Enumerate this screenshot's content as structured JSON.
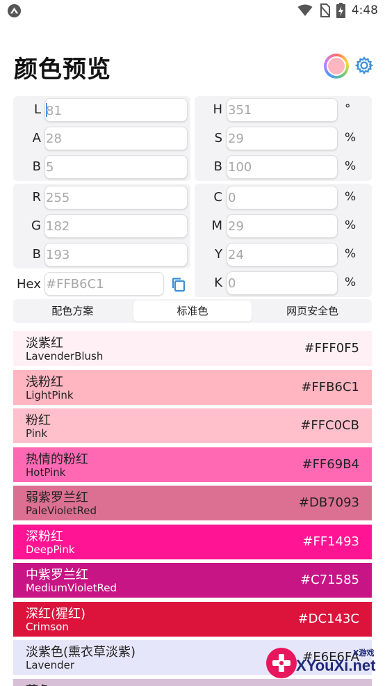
{
  "status_bar": {
    "time": "4:48"
  },
  "header": {
    "title": "颜色预览",
    "preview_color": "#FFB6C1"
  },
  "lab": {
    "rows": [
      {
        "label": "L",
        "value": "81"
      },
      {
        "label": "A",
        "value": "28"
      },
      {
        "label": "B",
        "value": "5"
      }
    ]
  },
  "hsb": {
    "rows": [
      {
        "label": "H",
        "value": "351",
        "unit": "°"
      },
      {
        "label": "S",
        "value": "29",
        "unit": "%"
      },
      {
        "label": "B",
        "value": "100",
        "unit": "%"
      }
    ]
  },
  "rgb": {
    "rows": [
      {
        "label": "R",
        "value": "255"
      },
      {
        "label": "G",
        "value": "182"
      },
      {
        "label": "B",
        "value": "193"
      }
    ]
  },
  "cmyk": {
    "rows": [
      {
        "label": "C",
        "value": "0",
        "unit": "%"
      },
      {
        "label": "M",
        "value": "29",
        "unit": "%"
      },
      {
        "label": "Y",
        "value": "24",
        "unit": "%"
      },
      {
        "label": "K",
        "value": "0",
        "unit": "%"
      }
    ]
  },
  "hex": {
    "label": "Hex",
    "value": "#FFB6C1"
  },
  "tabs": [
    {
      "label": "配色方案",
      "active": false
    },
    {
      "label": "标准色",
      "active": true
    },
    {
      "label": "网页安全色",
      "active": false
    }
  ],
  "colors": [
    {
      "cn": "淡紫红",
      "en": "LavenderBlush",
      "hex": "#FFF0F5",
      "bg": "#FFF0F5",
      "text": "#222222"
    },
    {
      "cn": "浅粉红",
      "en": "LightPink",
      "hex": "#FFB6C1",
      "bg": "#FFB6C1",
      "text": "#222222"
    },
    {
      "cn": "粉红",
      "en": "Pink",
      "hex": "#FFC0CB",
      "bg": "#FFC0CB",
      "text": "#222222"
    },
    {
      "cn": "热情的粉红",
      "en": "HotPink",
      "hex": "#FF69B4",
      "bg": "#FF69B4",
      "text": "#222222"
    },
    {
      "cn": "弱紫罗兰红",
      "en": "PaleVioletRed",
      "hex": "#DB7093",
      "bg": "#DB7093",
      "text": "#222222"
    },
    {
      "cn": "深粉红",
      "en": "DeepPink",
      "hex": "#FF1493",
      "bg": "#FF1493",
      "text": "#FFFFFF"
    },
    {
      "cn": "中紫罗兰红",
      "en": "MediumVioletRed",
      "hex": "#C71585",
      "bg": "#C71585",
      "text": "#FFFFFF"
    },
    {
      "cn": "深红(猩红)",
      "en": "Crimson",
      "hex": "#DC143C",
      "bg": "#DC143C",
      "text": "#FFFFFF"
    },
    {
      "cn": "淡紫色(熏衣草淡紫)",
      "en": "Lavender",
      "hex": "#E6E6FA",
      "bg": "#E6E6FA",
      "text": "#222222"
    },
    {
      "cn": "蓟色",
      "en": "",
      "hex": "",
      "bg": "#D8BFD8",
      "text": "#222222"
    }
  ],
  "watermark": {
    "site": "XYouXi.net",
    "tag": "X游戏"
  }
}
